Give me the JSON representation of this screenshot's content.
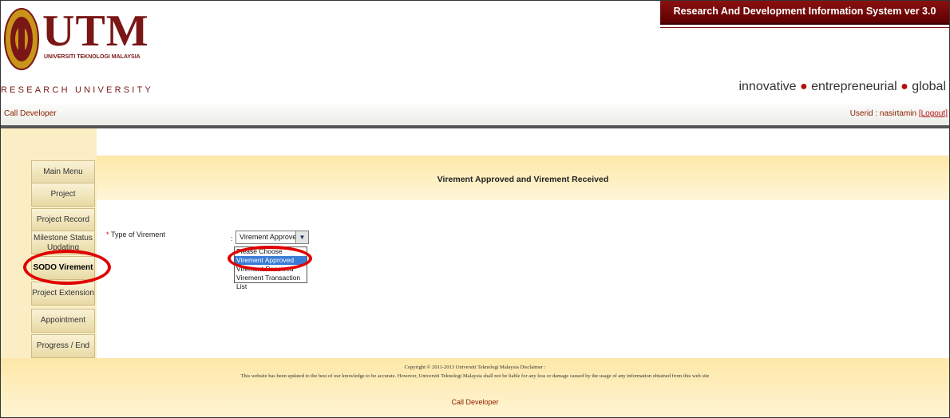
{
  "header": {
    "logo_text": "UTM",
    "logo_subtitle": "UNIVERSITI TEKNOLOGI MALAYSIA",
    "research_text": "RESEARCH UNIVERSITY",
    "system_title": "Research And Development Information System ver 3.0",
    "tagline": {
      "word1": "innovative",
      "word2": "entrepreneurial",
      "word3": "global",
      "dot": "●"
    }
  },
  "userbar": {
    "call_developer": "Call Developer",
    "userid_text": "Userid : nasirtamin ",
    "logout_label": "[Logout]"
  },
  "sidebar": {
    "items": [
      {
        "label": "Main Menu"
      },
      {
        "label": "Project Information"
      },
      {
        "label": "Project Record"
      },
      {
        "label": "Milestone Status"
      },
      {
        "label": "Updating"
      },
      {
        "label": "SODO Virement"
      },
      {
        "label": "Project Extension"
      },
      {
        "label": "Appointment"
      },
      {
        "label": "Progress / End Report"
      }
    ]
  },
  "main": {
    "title": "Virement Approved and Virement Received",
    "field": {
      "required_mark": "*",
      "label": "Type of Virement",
      "colon": ":",
      "selected": "Virement Approved",
      "arrow": "▼",
      "options": [
        "Please Choose",
        "Virement Approved",
        "Virement Received",
        "Virement Transaction List"
      ]
    }
  },
  "footer": {
    "copyright": "Copyright © 2011-2013 Universiti Teknologi Malaysia Disclaimer :",
    "disclaimer": "This website has been updated to the best of our knowledge to be accurate. However, Universiti Teknologi Malaysia shall not be liable for any loss or damage caused by the usage of any information obtained from this web site",
    "call_developer": "Call Developer"
  },
  "colors": {
    "brand_maroon": "#7a1616",
    "banner_red": "#8b1010",
    "sidebar_bg": "#fbeec4",
    "highlight_select": "#3a7bd5",
    "annotation_red": "#e00000"
  }
}
